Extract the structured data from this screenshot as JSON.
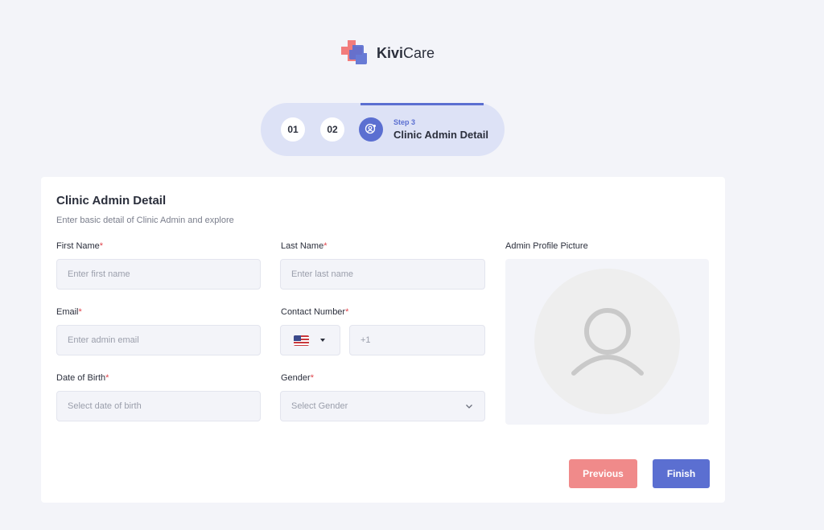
{
  "brand": {
    "name_bold": "Kivi",
    "name_rest": "Care",
    "colors": {
      "red": "#f27c7c",
      "blue": "#5b6fd1"
    }
  },
  "stepper": {
    "steps": [
      {
        "label": "01"
      },
      {
        "label": "02"
      }
    ],
    "active": {
      "step_label": "Step 3",
      "title": "Clinic Admin Detail",
      "icon": "user-settings-icon"
    }
  },
  "form": {
    "title": "Clinic Admin Detail",
    "subtitle": "Enter basic detail of Clinic Admin and explore",
    "required_mark": "*",
    "fields": {
      "first_name": {
        "label": "First Name",
        "placeholder": "Enter first name"
      },
      "last_name": {
        "label": "Last Name",
        "placeholder": "Enter last name"
      },
      "email": {
        "label": "Email",
        "placeholder": "Enter admin email"
      },
      "contact": {
        "label": "Contact Number",
        "country_icon": "us-flag-icon",
        "placeholder": "+1"
      },
      "dob": {
        "label": "Date of Birth",
        "placeholder": "Select date of birth"
      },
      "gender": {
        "label": "Gender",
        "placeholder": "Select Gender"
      }
    },
    "profile_picture": {
      "label": "Admin Profile Picture",
      "icon": "user-avatar-icon"
    }
  },
  "actions": {
    "previous": "Previous",
    "finish": "Finish"
  }
}
